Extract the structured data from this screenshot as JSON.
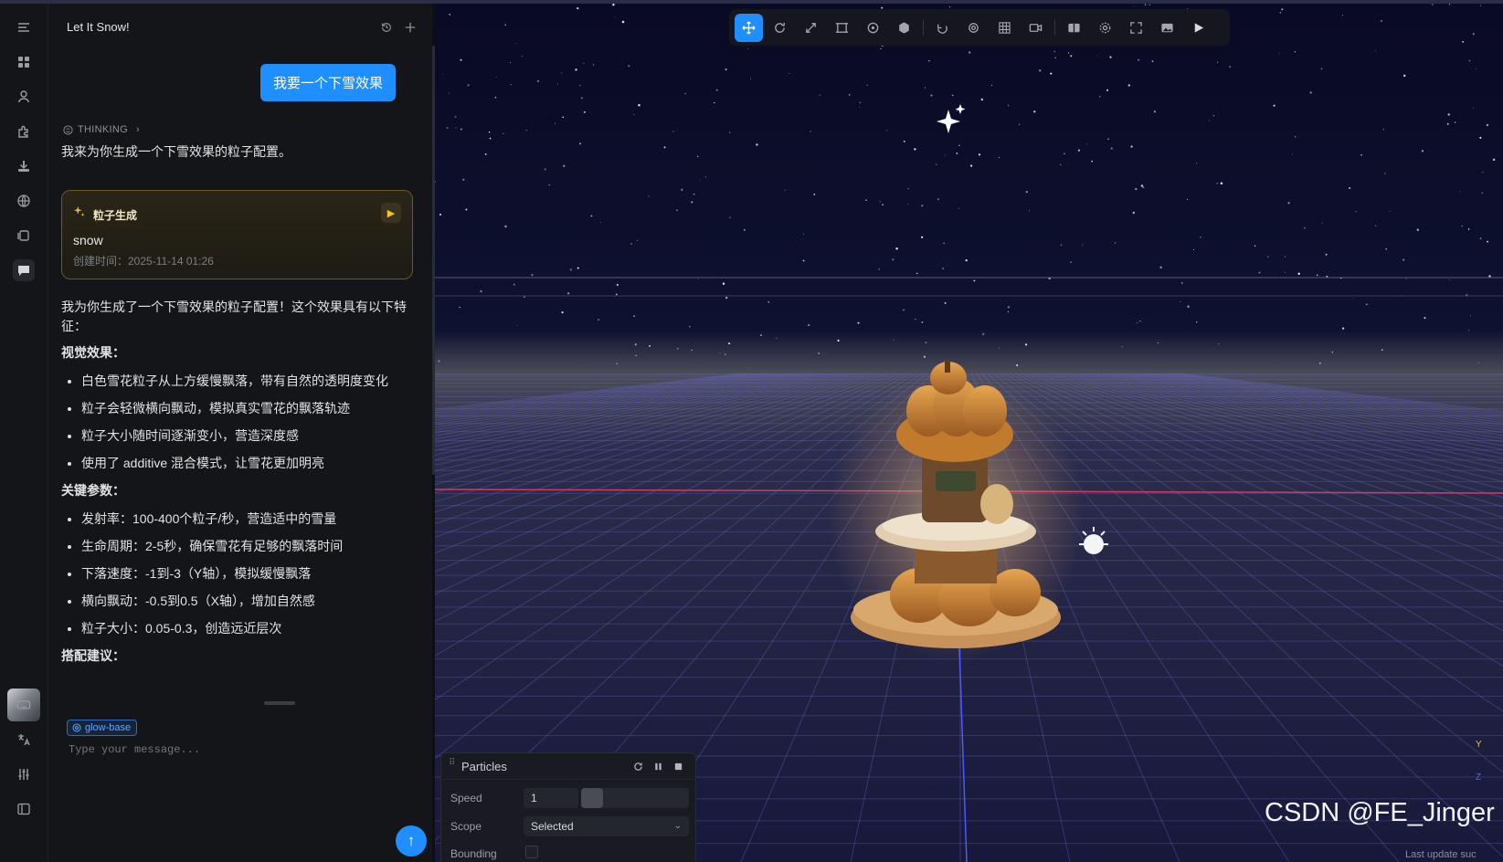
{
  "rail": {
    "items": [
      "menu-icon",
      "dashboard-icon",
      "user-icon",
      "puzzle-icon",
      "download-icon",
      "globe-icon",
      "layers-icon",
      "chat-icon"
    ],
    "bottom_items": [
      "keyboard-icon",
      "translate-icon",
      "sliders-icon",
      "sidebar-icon"
    ]
  },
  "chat": {
    "title": "Let It Snow!",
    "user_message": "我要一个下雪效果",
    "thinking_label": "THINKING",
    "intro": "我来为你生成一个下雪效果的粒子配置。",
    "card": {
      "label": "粒子生成",
      "name": "snow",
      "created": "创建时间：2025-11-14 01:26"
    },
    "response": {
      "lead": "我为你生成了一个下雪效果的粒子配置！这个效果具有以下特征：",
      "visual_heading": "视觉效果：",
      "visual_items": [
        "白色雪花粒子从上方缓慢飘落，带有自然的透明度变化",
        "粒子会轻微横向飘动，模拟真实雪花的飘落轨迹",
        "粒子大小随时间逐渐变小，营造深度感",
        "使用了 additive 混合模式，让雪花更加明亮"
      ],
      "params_heading": "关键参数：",
      "params_items": [
        "发射率：100-400个粒子/秒，营造适中的雪量",
        "生命周期：2-5秒，确保雪花有足够的飘落时间",
        "下落速度：-1到-3（Y轴），模拟缓慢飘落",
        "横向飘动：-0.5到0.5（X轴），增加自然感",
        "粒子大小：0.05-0.3，创造远近层次"
      ],
      "tips_heading": "搭配建议："
    },
    "input": {
      "tag": "glow-base",
      "placeholder": "Type your message..."
    }
  },
  "toolbar": {
    "tools": [
      "move-icon",
      "rotate-icon",
      "scale-icon",
      "rect-icon",
      "circle-icon",
      "sphere-icon",
      "undo-icon",
      "target-icon",
      "grid-icon",
      "camera-icon",
      "split-icon",
      "settings-icon",
      "fullscreen-icon",
      "image-icon",
      "play-icon"
    ],
    "active": "move-icon"
  },
  "particles_panel": {
    "title": "Particles",
    "speed_label": "Speed",
    "speed_value": "1",
    "scope_label": "Scope",
    "scope_value": "Selected",
    "bounding_label": "Bounding",
    "bounding_checked": false
  },
  "axes": {
    "y": "Y",
    "z": "Z"
  },
  "watermark": "CSDN @FE_Jinger",
  "footnote": "Last update suc"
}
